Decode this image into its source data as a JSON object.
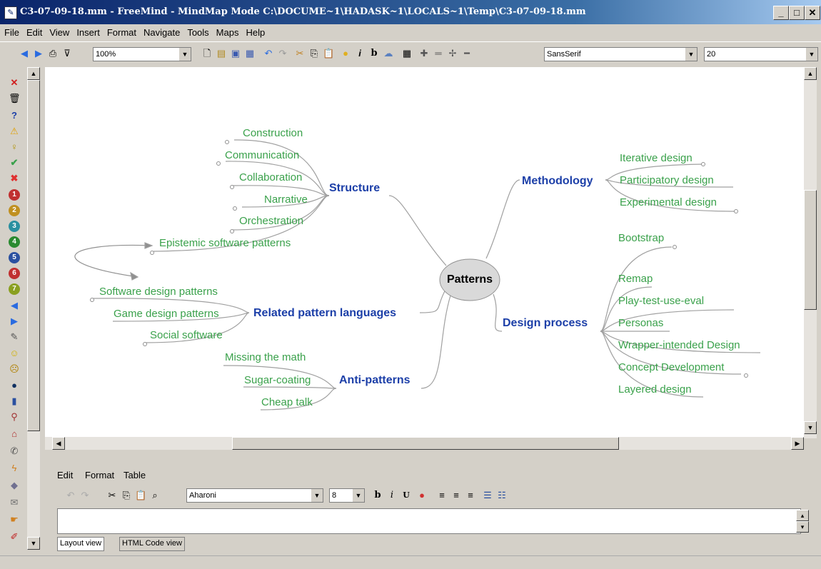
{
  "window": {
    "title": "C3-07-09-18.mm - FreeMind - MindMap Mode C:\\DOCUME~1\\HADASK~1\\LOCALS~1\\Temp\\C3-07-09-18.mm"
  },
  "menu": [
    "File",
    "Edit",
    "View",
    "Insert",
    "Format",
    "Navigate",
    "Tools",
    "Maps",
    "Help"
  ],
  "toolbar": {
    "zoom_value": "100%",
    "font_family": "SansSerif",
    "font_size": "20"
  },
  "mindmap": {
    "root": "Patterns",
    "structure": {
      "label": "Structure",
      "children": [
        "Construction",
        "Communication",
        "Collaboration",
        "Narrative",
        "Orchestration",
        "Epistemic software patterns"
      ]
    },
    "related": {
      "label": "Related pattern languages",
      "children": [
        "Software design patterns",
        "Game design patterns",
        "Social software"
      ]
    },
    "anti": {
      "label": "Anti-patterns",
      "children": [
        "Missing the math",
        "Sugar-coating",
        "Cheap talk"
      ]
    },
    "methodology": {
      "label": "Methodology",
      "children": [
        "Iterative design",
        "Participatory design",
        "Experimental design"
      ]
    },
    "design_process": {
      "label": "Design process",
      "children": [
        "Bootstrap",
        "Remap",
        "Play-test-use-eval",
        "Personas",
        "Wrapper-intended Design",
        "Concept Development",
        "Layered design"
      ]
    }
  },
  "note_editor": {
    "menu": [
      "Edit",
      "Format",
      "Table"
    ],
    "font_family": "Aharoni",
    "font_size": "8",
    "tabs": [
      "Layout view",
      "HTML Code view"
    ]
  },
  "colors": {
    "leaf": "#3aa14b",
    "hub": "#1c3fa8",
    "root_fill": "#d9d9d9",
    "edge": "#a0a0a0"
  }
}
